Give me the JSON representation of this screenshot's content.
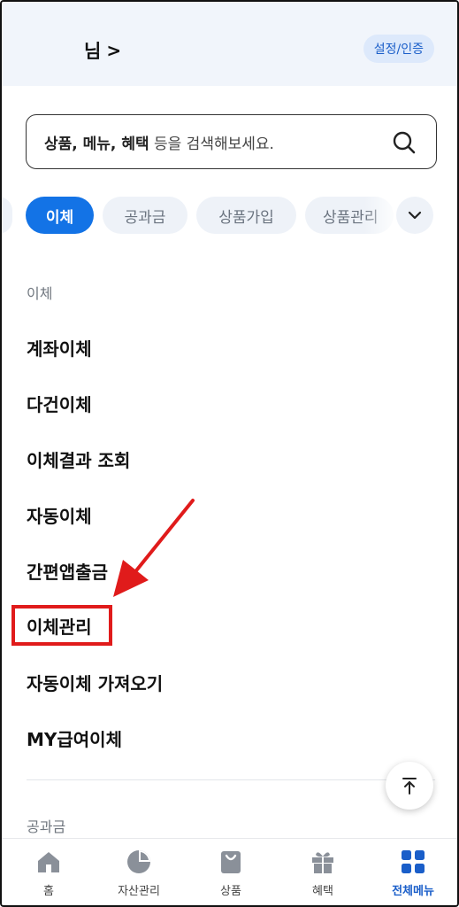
{
  "header": {
    "user_suffix": "님",
    "chevron": ">",
    "settings_label": "설정/인증"
  },
  "search": {
    "placeholder_bold": "상품, 메뉴, 혜택",
    "placeholder_rest": " 등을 검색해보세요."
  },
  "chips": [
    {
      "label": "이체",
      "active": true
    },
    {
      "label": "공과금",
      "active": false
    },
    {
      "label": "상품가입",
      "active": false
    },
    {
      "label": "상품관리",
      "active": false
    }
  ],
  "sections": [
    {
      "title": "이체",
      "items": [
        "계좌이체",
        "다건이체",
        "이체결과 조회",
        "자동이체",
        "간편앱출금",
        "이체관리",
        "자동이체 가져오기",
        "MY급여이체"
      ]
    },
    {
      "title": "공과금",
      "items": []
    }
  ],
  "annotation": {
    "highlighted_item": "이체관리",
    "color": "#e01b1b"
  },
  "bottom_nav": [
    {
      "label": "홈",
      "icon": "home-icon",
      "active": false
    },
    {
      "label": "자산관리",
      "icon": "pie-chart-icon",
      "active": false
    },
    {
      "label": "상품",
      "icon": "shopping-bag-icon",
      "active": false
    },
    {
      "label": "혜택",
      "icon": "gift-icon",
      "active": false
    },
    {
      "label": "전체메뉴",
      "icon": "grid-menu-icon",
      "active": true
    }
  ],
  "colors": {
    "accent": "#1373e6",
    "header_bg": "#f1f5fb",
    "chip_bg": "#eef2f8"
  }
}
